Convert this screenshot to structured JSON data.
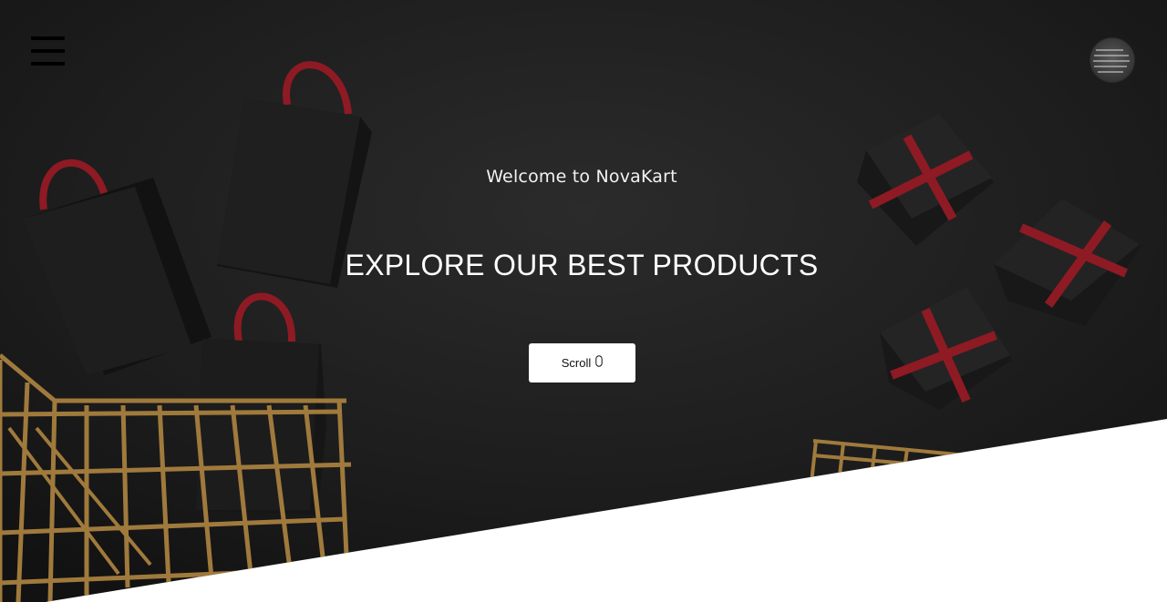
{
  "hero": {
    "welcome_text": "Welcome to NovaKart",
    "headline": "EXPLORE OUR BEST PRODUCTS",
    "scroll_label": "Scroll",
    "scroll_icon": "mouse-icon"
  },
  "header": {
    "menu_icon": "hamburger-menu-icon",
    "avatar_icon": "user-avatar"
  },
  "colors": {
    "background": "#1b1b1b",
    "button_bg": "#ffffff",
    "accent_red": "#8e1a24",
    "basket_gold": "#a07a3c"
  }
}
